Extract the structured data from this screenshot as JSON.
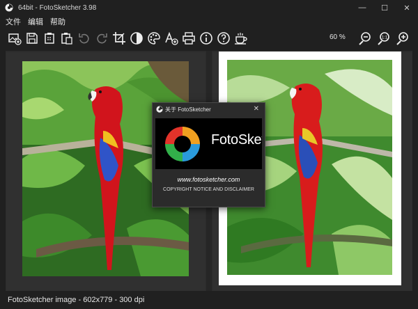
{
  "window": {
    "title": "64bit - FotoSketcher 3.98",
    "minimize": "—",
    "maximize": "☐",
    "close": "✕"
  },
  "menu": [
    "文件",
    "编辑",
    "帮助"
  ],
  "toolbar": {
    "zoom_level": "60 %",
    "buttons": [
      "open-image",
      "save",
      "copy",
      "paste",
      "undo",
      "redo",
      "crop",
      "contrast",
      "palette",
      "add-text",
      "print",
      "info",
      "help",
      "coffee"
    ],
    "zoom_buttons": [
      "zoom-out",
      "zoom-1-1",
      "zoom-in"
    ]
  },
  "dialog": {
    "title": "关于 FotoSketcher",
    "close": "✕",
    "logo_text": "FotoSketcher",
    "url": "www.fotosketcher.com",
    "copyright": "COPYRIGHT NOTICE AND DISCLAIMER"
  },
  "status": {
    "text": "FotoSketcher image - 602x779 - 300 dpi"
  },
  "colors": {
    "background": "#202020",
    "panel": "#303030",
    "parrot_red": "#d1141c",
    "jungle_green": "#3f8a2e"
  }
}
